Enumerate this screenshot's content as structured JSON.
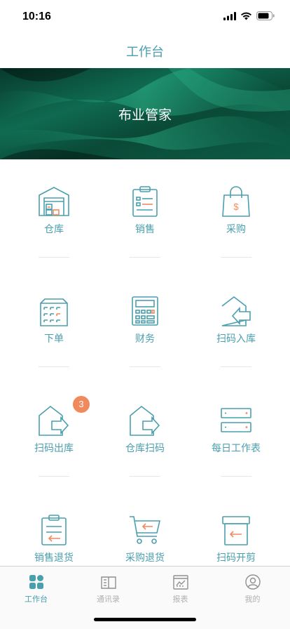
{
  "status": {
    "time": "10:16"
  },
  "header": {
    "title": "工作台"
  },
  "banner": {
    "title": "布业管家"
  },
  "grid": [
    {
      "label": "仓库",
      "icon": "warehouse-icon"
    },
    {
      "label": "销售",
      "icon": "clipboard-list-icon"
    },
    {
      "label": "采购",
      "icon": "shopping-bag-icon"
    },
    {
      "label": "下单",
      "icon": "building-icon"
    },
    {
      "label": "财务",
      "icon": "calculator-icon"
    },
    {
      "label": "扫码入库",
      "icon": "house-arrow-in-icon"
    },
    {
      "label": "扫码出库",
      "icon": "house-arrow-out-icon",
      "badge": "3"
    },
    {
      "label": "仓库扫码",
      "icon": "house-arrow-right-icon"
    },
    {
      "label": "每日工作表",
      "icon": "server-rack-icon"
    },
    {
      "label": "销售退货",
      "icon": "clipboard-return-icon"
    },
    {
      "label": "采购退货",
      "icon": "cart-return-icon"
    },
    {
      "label": "扫码开剪",
      "icon": "box-return-icon"
    }
  ],
  "tabbar": [
    {
      "label": "工作台",
      "icon": "grid-icon",
      "active": true
    },
    {
      "label": "通讯录",
      "icon": "book-icon",
      "active": false
    },
    {
      "label": "报表",
      "icon": "report-icon",
      "active": false
    },
    {
      "label": "我的",
      "icon": "user-icon",
      "active": false
    }
  ],
  "colors": {
    "accent": "#4a9fae",
    "orange": "#f08a5d",
    "banner": "#0e5a45"
  }
}
